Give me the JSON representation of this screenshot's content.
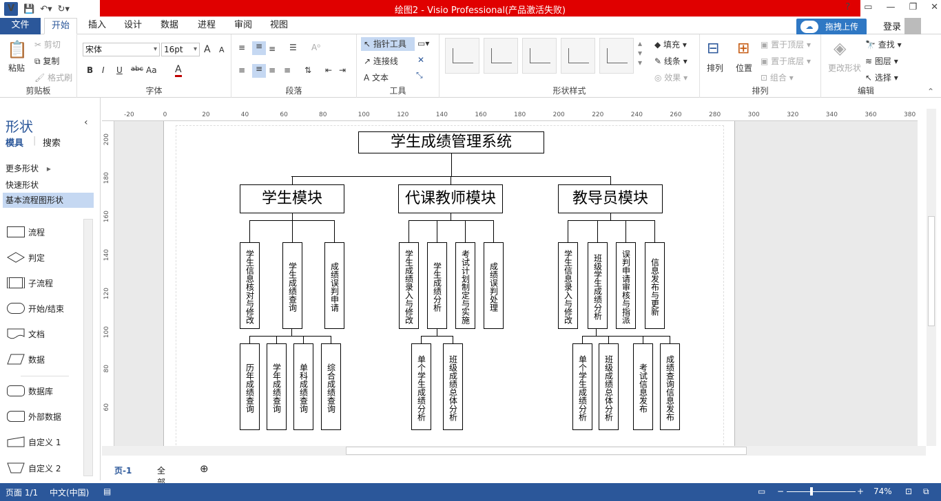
{
  "window": {
    "title": "绘图2 - Visio Professional(产品激活失败)",
    "controls": [
      "?",
      "▭",
      "—",
      "❐",
      "✕"
    ]
  },
  "tabs": [
    "文件",
    "开始",
    "插入",
    "设计",
    "数据",
    "进程",
    "审阅",
    "视图"
  ],
  "account": {
    "upload": "拖拽上传",
    "login": "登录"
  },
  "ribbon": {
    "clipboard": {
      "paste": "粘贴",
      "cut": "剪切",
      "copy": "复制",
      "format_painter": "格式刷",
      "label": "剪贴板"
    },
    "font": {
      "name": "宋体",
      "size": "16pt",
      "grow": "A",
      "shrink": "A",
      "bold": "B",
      "italic": "I",
      "underline": "U",
      "strike": "abc",
      "case": "Aa",
      "color": "A",
      "label": "字体"
    },
    "paragraph": {
      "label": "段落"
    },
    "tools": {
      "pointer": "指针工具",
      "connector": "连接线",
      "text": "文本",
      "label": "工具"
    },
    "shape_styles": {
      "fill": "填充",
      "line": "线条",
      "effect": "效果",
      "label": "形状样式"
    },
    "arrange": {
      "align": "排列",
      "position": "位置",
      "bring_front": "置于顶层",
      "send_back": "置于底层",
      "group": "组合",
      "label": "排列"
    },
    "editing": {
      "change_shape": "更改形状",
      "find": "查找",
      "layers": "图层",
      "select": "选择",
      "label": "编辑"
    }
  },
  "shapes_panel": {
    "title": "形状",
    "tabs": [
      "模具",
      "搜索"
    ],
    "items": [
      "更多形状",
      "快速形状",
      "基本流程图形状"
    ],
    "shapes": [
      "流程",
      "判定",
      "子流程",
      "开始/结束",
      "文档",
      "数据",
      "数据库",
      "外部数据",
      "自定义 1",
      "自定义 2"
    ]
  },
  "ruler": {
    "h": [
      "-20",
      "0",
      "20",
      "40",
      "60",
      "80",
      "100",
      "120",
      "140",
      "160",
      "180",
      "200",
      "220",
      "240",
      "260",
      "280",
      "300",
      "320",
      "340",
      "360",
      "380"
    ],
    "v": [
      "200",
      "180",
      "160",
      "140",
      "120",
      "100",
      "80",
      "60"
    ]
  },
  "diagram": {
    "root": "学生成绩管理系统",
    "modules": [
      {
        "name": "学生模块",
        "children": [
          "学生信息核对与修改",
          "学生成绩查询",
          "成绩误判申请"
        ],
        "grandchildren": [
          "历年成绩查询",
          "学年成绩查询",
          "单科成绩查询",
          "综合成绩查询"
        ]
      },
      {
        "name": "代课教师模块",
        "children": [
          "学生成绩录入与修改",
          "学生成绩分析",
          "考试计划制定与实施",
          "成绩误判处理"
        ],
        "grandchildren": [
          "单个学生成绩分析",
          "班级成绩总体分析"
        ]
      },
      {
        "name": "教导员模块",
        "children": [
          "学生信息录入与修改",
          "班级学生成绩分析",
          "误判申请审核与指派",
          "信息发布与更新"
        ],
        "grandchildren": [
          "单个学生成绩分析",
          "班级成绩总体分析",
          "考试信息发布",
          "成绩查询信息发布"
        ]
      }
    ]
  },
  "page_tabs": {
    "page": "页-1",
    "all": "全部"
  },
  "status": {
    "page": "页面 1/1",
    "lang": "中文(中国)",
    "zoom": "74%"
  }
}
